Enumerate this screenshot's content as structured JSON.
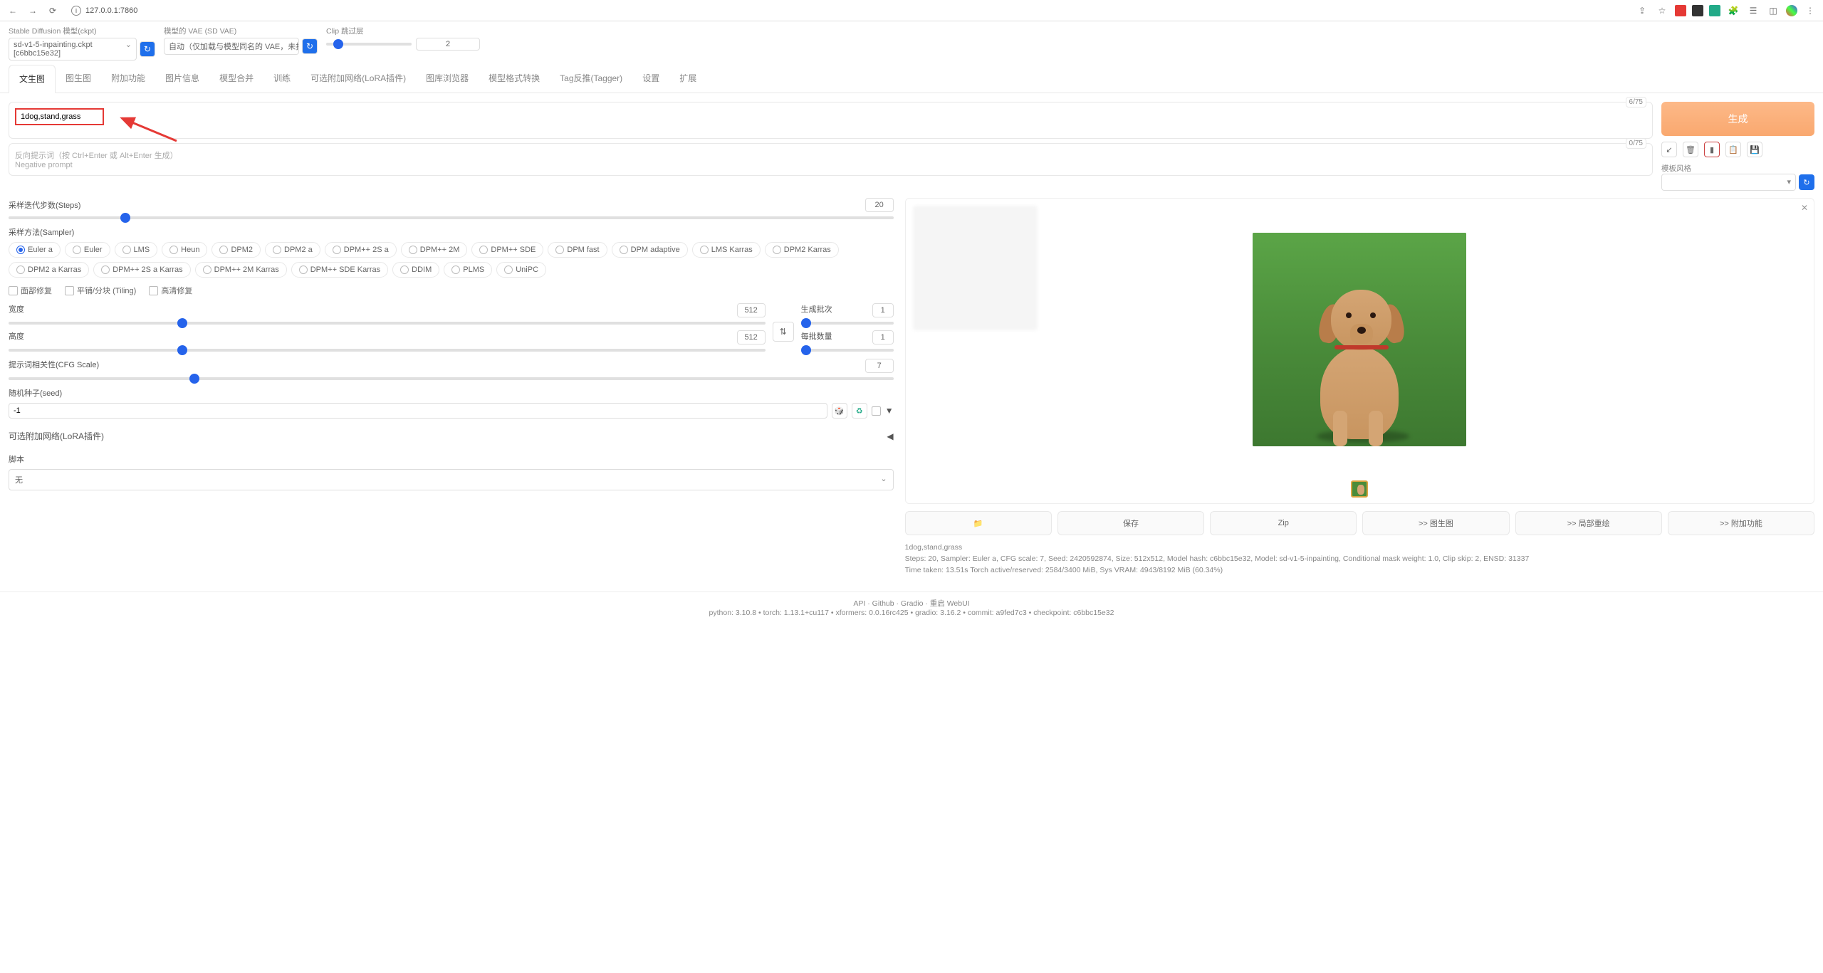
{
  "browser": {
    "url": "127.0.0.1:7860"
  },
  "config": {
    "model": {
      "label": "Stable Diffusion 模型(ckpt)",
      "value": "sd-v1-5-inpainting.ckpt [c6bbc15e32]"
    },
    "vae": {
      "label": "模型的 VAE (SD VAE)",
      "value": "自动（仅加载与模型同名的 VAE，未找到时不加载）"
    },
    "clip": {
      "label": "Clip 跳过层",
      "value": "2"
    }
  },
  "tabs": [
    "文生图",
    "图生图",
    "附加功能",
    "图片信息",
    "模型合并",
    "训练",
    "可选附加网络(LoRA插件)",
    "图库浏览器",
    "模型格式转换",
    "Tag反推(Tagger)",
    "设置",
    "扩展"
  ],
  "activeTab": 0,
  "prompt": {
    "value": "1dog,stand,grass",
    "count": "6/75"
  },
  "negPrompt": {
    "placeholder1": "反向提示词（按 Ctrl+Enter 或 Alt+Enter 生成）",
    "placeholder2": "Negative prompt",
    "count": "0/75"
  },
  "generate": "生成",
  "style": {
    "label": "模板风格"
  },
  "steps": {
    "label": "采样迭代步数(Steps)",
    "value": "20"
  },
  "sampler": {
    "label": "采样方法(Sampler)",
    "options": [
      "Euler a",
      "Euler",
      "LMS",
      "Heun",
      "DPM2",
      "DPM2 a",
      "DPM++ 2S a",
      "DPM++ 2M",
      "DPM++ SDE",
      "DPM fast",
      "DPM adaptive",
      "LMS Karras",
      "DPM2 Karras",
      "DPM2 a Karras",
      "DPM++ 2S a Karras",
      "DPM++ 2M Karras",
      "DPM++ SDE Karras",
      "DDIM",
      "PLMS",
      "UniPC"
    ],
    "selected": 0
  },
  "checks": {
    "face": "面部修复",
    "tile": "平铺/分块 (Tiling)",
    "hires": "高清修复"
  },
  "width": {
    "label": "宽度",
    "value": "512"
  },
  "height": {
    "label": "高度",
    "value": "512"
  },
  "batchCount": {
    "label": "生成批次",
    "value": "1"
  },
  "batchSize": {
    "label": "每批数量",
    "value": "1"
  },
  "cfg": {
    "label": "提示词相关性(CFG Scale)",
    "value": "7"
  },
  "seed": {
    "label": "随机种子(seed)",
    "value": "-1"
  },
  "lora": {
    "label": "可选附加网络(LoRA插件)"
  },
  "script": {
    "label": "脚本",
    "value": "无"
  },
  "actions": {
    "folder": "📁",
    "save": "保存",
    "zip": "Zip",
    "img2img": ">> 图生图",
    "inpaint": ">> 局部重绘",
    "extras": ">> 附加功能"
  },
  "outputInfo": {
    "prompt": "1dog,stand,grass",
    "params": "Steps: 20, Sampler: Euler a, CFG scale: 7, Seed: 2420592874, Size: 512x512, Model hash: c6bbc15e32, Model: sd-v1-5-inpainting, Conditional mask weight: 1.0, Clip skip: 2, ENSD: 31337",
    "time": "Time taken: 13.51s   Torch active/reserved: 2584/3400 MiB, Sys VRAM: 4943/8192 MiB (60.34%)"
  },
  "footer": {
    "links": "API  ·  Github  ·  Gradio  ·  重启 WebUI",
    "versions": "python: 3.10.8  •  torch: 1.13.1+cu117  •  xformers: 0.0.16rc425  •  gradio: 3.16.2  •  commit: a9fed7c3  •  checkpoint: c6bbc15e32"
  }
}
